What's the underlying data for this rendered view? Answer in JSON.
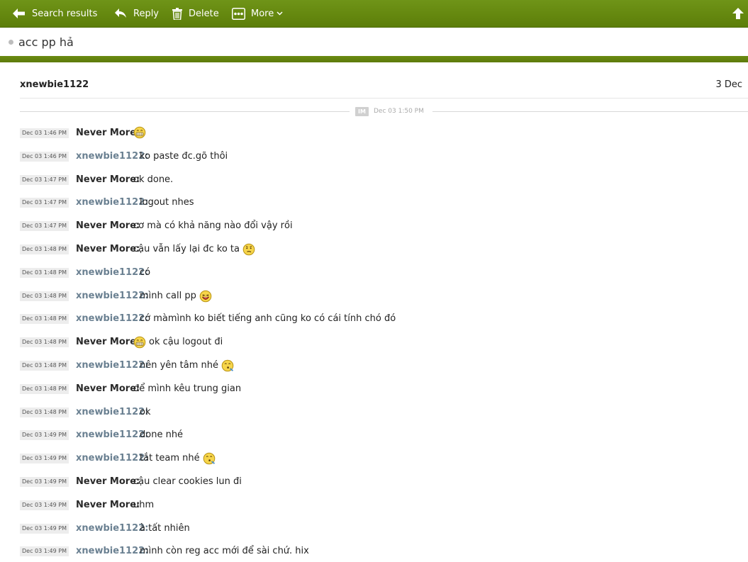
{
  "toolbar": {
    "back_label": "Search results",
    "reply_label": "Reply",
    "delete_label": "Delete",
    "more_label": "More"
  },
  "subject": "acc pp hả",
  "header": {
    "sender": "xnewbie1122",
    "date": "3 Dec"
  },
  "im_separator": {
    "badge": "IM",
    "time": "Dec 03 1:50 PM"
  },
  "colors": {
    "toolbar": "#65880f",
    "accent": "#5d7a0a",
    "sender_xn": "#6b8192",
    "sender_nm": "#2a2a2a"
  },
  "messages": [
    {
      "time": "Dec 03 1:46 PM",
      "sender": "Never More:",
      "who": "nm",
      "text": "",
      "emoji": "grin-icon",
      "emoji_pos": "end"
    },
    {
      "time": "Dec 03 1:46 PM",
      "sender": "xnewbie1122:",
      "who": "xn",
      "text": "ko paste đc.gõ thôi"
    },
    {
      "time": "Dec 03 1:47 PM",
      "sender": "Never More:",
      "who": "nm",
      "text": "ok done."
    },
    {
      "time": "Dec 03 1:47 PM",
      "sender": "xnewbie1122:",
      "who": "xn",
      "text": "logout nhes"
    },
    {
      "time": "Dec 03 1:47 PM",
      "sender": "Never More:",
      "who": "nm",
      "text": "cơ mà có khả năng nào đổi vậy rồi"
    },
    {
      "time": "Dec 03 1:48 PM",
      "sender": "Never More:",
      "who": "nm",
      "text": "cậu vẫn lấy lại đc ko ta",
      "emoji": "thinking-icon",
      "emoji_pos": "end"
    },
    {
      "time": "Dec 03 1:48 PM",
      "sender": "xnewbie1122:",
      "who": "xn",
      "text": "có"
    },
    {
      "time": "Dec 03 1:48 PM",
      "sender": "xnewbie1122:",
      "who": "xn",
      "text": "mình call pp",
      "emoji": "laugh-icon",
      "emoji_pos": "end"
    },
    {
      "time": "Dec 03 1:48 PM",
      "sender": "xnewbie1122:",
      "who": "xn",
      "text": "cớ màmình ko biết tiếng anh cũng ko có cái tính chó đó"
    },
    {
      "time": "Dec 03 1:48 PM",
      "sender": "Never More:",
      "who": "nm",
      "text": "ok cậu logout đi",
      "emoji": "grin-icon",
      "emoji_pos": "start"
    },
    {
      "time": "Dec 03 1:48 PM",
      "sender": "xnewbie1122:",
      "who": "xn",
      "text": "nên yên tâm nhé",
      "emoji": "whistle-icon",
      "emoji_pos": "end"
    },
    {
      "time": "Dec 03 1:48 PM",
      "sender": "Never More:",
      "who": "nm",
      "text": "để mình kêu trung gian"
    },
    {
      "time": "Dec 03 1:48 PM",
      "sender": "xnewbie1122:",
      "who": "xn",
      "text": "ok"
    },
    {
      "time": "Dec 03 1:49 PM",
      "sender": "xnewbie1122:",
      "who": "xn",
      "text": "done nhé"
    },
    {
      "time": "Dec 03 1:49 PM",
      "sender": "xnewbie1122:",
      "who": "xn",
      "text": "tắt team nhé",
      "emoji": "whistle-icon",
      "emoji_pos": "end"
    },
    {
      "time": "Dec 03 1:49 PM",
      "sender": "Never More:",
      "who": "nm",
      "text": "cậu clear cookies lun đi"
    },
    {
      "time": "Dec 03 1:49 PM",
      "sender": "Never More:",
      "who": "nm",
      "text": "uhm"
    },
    {
      "time": "Dec 03 1:49 PM",
      "sender": "xnewbie1122:",
      "who": "xn",
      "text": "à tất nhiên"
    },
    {
      "time": "Dec 03 1:49 PM",
      "sender": "xnewbie1122:",
      "who": "xn",
      "text": "mình còn reg acc mới để sài chứ. hix"
    }
  ]
}
